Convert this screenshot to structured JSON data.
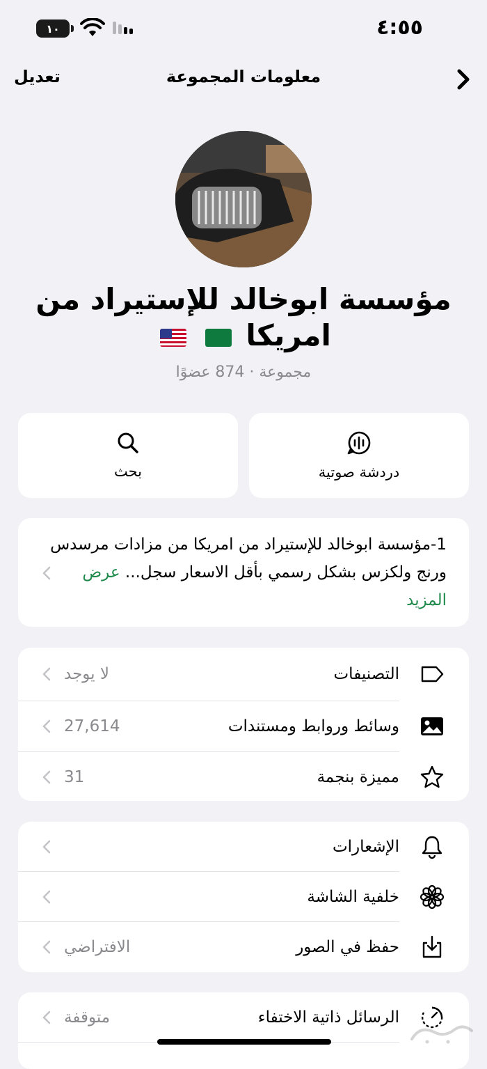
{
  "status_bar": {
    "time": "٤:٥٥",
    "battery": "١٠"
  },
  "nav": {
    "title": "معلومات المجموعة",
    "edit_label": "تعديل"
  },
  "group": {
    "name": "مؤسسة ابوخالد للإستيراد من امريكا",
    "subtitle": "مجموعة · 874 عضوًا"
  },
  "actions": [
    {
      "label": "دردشة صوتية",
      "icon": "voice-chat-icon"
    },
    {
      "label": "بحث",
      "icon": "search-icon"
    }
  ],
  "description": {
    "text": "1-مؤسسة ابوخالد للإستيراد من امريكا من مزادات مرسدس ورنج ولكزس بشكل رسمي بأقل الاسعار سجل...",
    "more_label": "عرض المزيد"
  },
  "section1": [
    {
      "label": "التصنيفات",
      "value": "لا يوجد",
      "icon": "tag-icon"
    },
    {
      "label": "وسائط وروابط ومستندات",
      "value": "27,614",
      "icon": "photo-icon"
    },
    {
      "label": "مميزة بنجمة",
      "value": "31",
      "icon": "star-icon"
    }
  ],
  "section2": [
    {
      "label": "الإشعارات",
      "value": "",
      "icon": "bell-icon"
    },
    {
      "label": "خلفية الشاشة",
      "value": "",
      "icon": "flower-icon"
    },
    {
      "label": "حفظ في الصور",
      "value": "الافتراضي",
      "icon": "save-download-icon"
    }
  ],
  "section3": [
    {
      "label": "الرسائل ذاتية الاختفاء",
      "value": "متوقفة",
      "icon": "timer-icon"
    }
  ],
  "colors": {
    "background": "#f2f2f6",
    "card": "#ffffff",
    "accent_link": "#1f8a4c",
    "secondary_text": "#8a8a8e"
  }
}
